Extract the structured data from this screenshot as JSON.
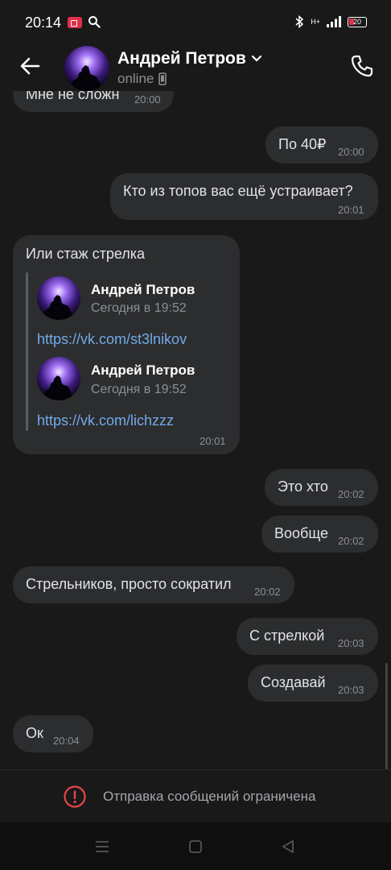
{
  "status_bar": {
    "time": "20:14",
    "battery": "20",
    "signal_text": "H+"
  },
  "header": {
    "contact_name": "Андрей Петров",
    "status": "online"
  },
  "messages": [
    {
      "side": "in",
      "text": "Мне не сложн",
      "time": "20:00"
    },
    {
      "side": "out",
      "text": "По 40₽",
      "time": "20:00"
    },
    {
      "side": "out",
      "text": "Кто из топов вас ещё устраивает?",
      "time": "20:01"
    },
    {
      "side": "in",
      "text": "Или стаж стрелка",
      "time": "20:01",
      "forwarded": [
        {
          "name": "Андрей Петров",
          "date": "Сегодня в 19:52",
          "link": "https://vk.com/st3lnikov"
        },
        {
          "name": "Андрей Петров",
          "date": "Сегодня в 19:52",
          "link": "https://vk.com/lichzzz"
        }
      ]
    },
    {
      "side": "out",
      "text": "Это хто",
      "time": "20:02"
    },
    {
      "side": "out",
      "text": "Вообще",
      "time": "20:02"
    },
    {
      "side": "in",
      "text": "Стрельников, просто сократил",
      "time": "20:02"
    },
    {
      "side": "out",
      "text": "С стрелкой",
      "time": "20:03"
    },
    {
      "side": "out",
      "text": "Создавай",
      "time": "20:03"
    },
    {
      "side": "in",
      "text": "Ок",
      "time": "20:04"
    }
  ],
  "notice": {
    "text": "Отправка сообщений ограничена",
    "icon": "alert-circle-icon",
    "icon_color": "#e64646"
  },
  "colors": {
    "background": "#191919",
    "bubble": "#2c2d2e",
    "link": "#71aaeb",
    "secondary_text": "#8c8f94"
  }
}
